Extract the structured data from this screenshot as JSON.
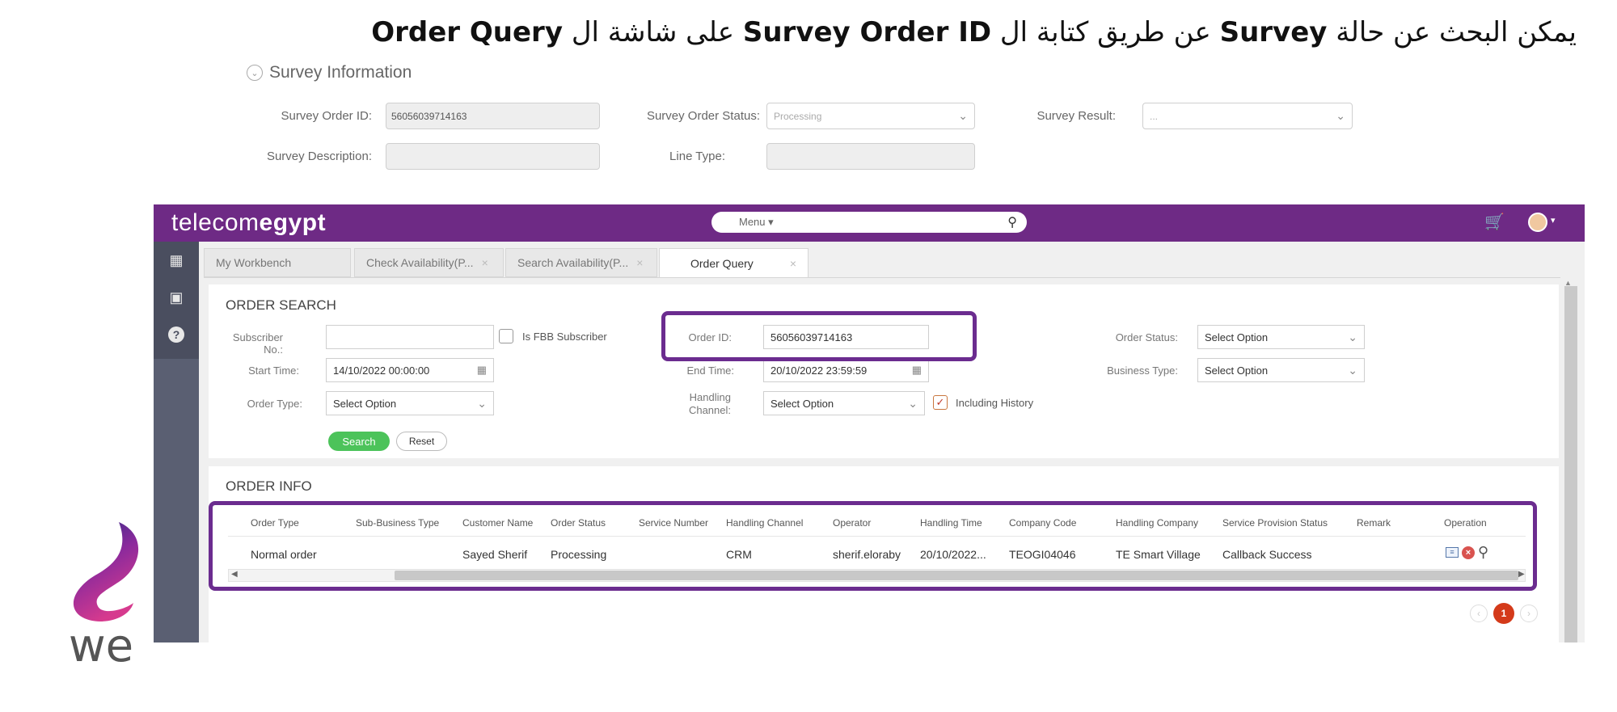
{
  "heading": {
    "p1": "يمكن البحث عن حالة",
    "k1": "Survey",
    "p2": "عن طريق كتابة ال",
    "k2": "Survey Order ID",
    "p3": "على شاشة ال",
    "k3": "Order Query"
  },
  "survey": {
    "section_title": "Survey Information",
    "order_id_label": "Survey Order ID:",
    "order_id_value": "56056039714163",
    "status_label": "Survey Order Status:",
    "status_value": "Processing",
    "result_label": "Survey Result:",
    "result_value": "...",
    "description_label": "Survey Description:",
    "line_type_label": "Line Type:"
  },
  "app": {
    "logo_light": "telecom",
    "logo_bold": "egypt",
    "menu_label": "Menu ▾"
  },
  "tabs": [
    {
      "label": "My Workbench"
    },
    {
      "label": "Check Availability(P..."
    },
    {
      "label": "Search Availability(P..."
    },
    {
      "label": "Order Query"
    }
  ],
  "search": {
    "title": "ORDER SEARCH",
    "subscriber_label": "Subscriber No.:",
    "subscriber_value": "",
    "fbb_label": "Is FBB Subscriber",
    "order_id_label": "Order ID:",
    "order_id_value": "56056039714163",
    "order_status_label": "Order Status:",
    "order_status_value": "Select Option",
    "start_time_label": "Start Time:",
    "start_time_value": "14/10/2022 00:00:00",
    "end_time_label": "End Time:",
    "end_time_value": "20/10/2022 23:59:59",
    "business_type_label": "Business Type:",
    "business_type_value": "Select Option",
    "order_type_label": "Order Type:",
    "order_type_value": "Select Option",
    "handling_channel_label_1": "Handling",
    "handling_channel_label_2": "Channel:",
    "handling_channel_value": "Select Option",
    "including_history_label": "Including History",
    "search_button": "Search",
    "reset_button": "Reset"
  },
  "info": {
    "title": "ORDER INFO",
    "columns": [
      "Order Type",
      "Sub-Business Type",
      "Customer Name",
      "Order Status",
      "Service Number",
      "Handling Channel",
      "Operator",
      "Handling Time",
      "Company Code",
      "Handling Company",
      "Service Provision Status",
      "Remark",
      "Operation"
    ],
    "row": {
      "order_type": "Normal order",
      "sub_business_type": "",
      "customer_name": "Sayed Sherif",
      "order_status": "Processing",
      "service_number": "",
      "handling_channel": "CRM",
      "operator": "sherif.eloraby",
      "handling_time": "20/10/2022...",
      "company_code": "TEOGI04046",
      "handling_company": "TE Smart Village",
      "service_provision_status": "Callback Success",
      "remark": ""
    },
    "current_page": "1"
  },
  "brand": {
    "we_text": "we"
  },
  "colors": {
    "brand_purple": "#6e2a85",
    "highlight_purple": "#6b2c8f",
    "search_green": "#4cc35a",
    "page_red": "#d43a1a"
  }
}
